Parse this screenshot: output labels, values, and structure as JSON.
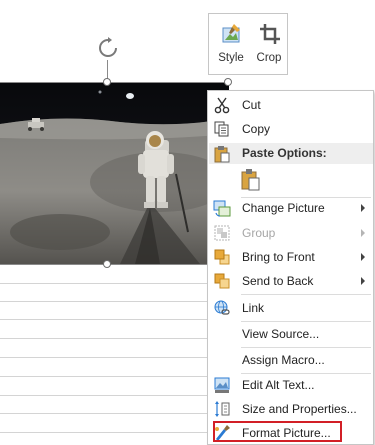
{
  "mini_toolbar": {
    "style_label": "Style",
    "crop_label": "Crop"
  },
  "context_menu": {
    "cut": "Cut",
    "copy": "Copy",
    "paste_options_header": "Paste Options:",
    "change_picture": "Change Picture",
    "group": "Group",
    "bring_to_front": "Bring to Front",
    "send_to_back": "Send to Back",
    "link": "Link",
    "view_source": "View Source...",
    "assign_macro": "Assign Macro...",
    "edit_alt_text": "Edit Alt Text...",
    "size_and_properties": "Size and Properties...",
    "format_picture": "Format Picture..."
  },
  "colors": {
    "highlight_border": "#d21f26",
    "icon_blue": "#2b7bd3",
    "icon_orange": "#e8a93a"
  },
  "icons": {
    "cut": "scissors-icon",
    "copy": "copy-icon",
    "paste": "clipboard-icon",
    "change_picture": "picture-swap-icon",
    "group": "group-icon",
    "bring_to_front": "bring-front-icon",
    "send_to_back": "send-back-icon",
    "link": "link-globe-icon",
    "edit_alt_text": "alt-text-icon",
    "size_and_properties": "size-icon",
    "format_picture": "format-brush-icon",
    "rotate": "rotate-handle-icon",
    "style": "style-brush-icon",
    "crop": "crop-icon"
  }
}
